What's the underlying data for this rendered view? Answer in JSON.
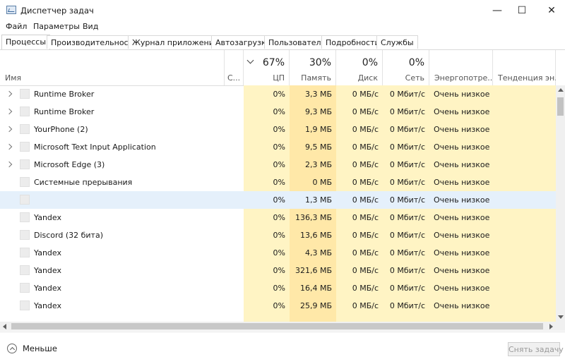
{
  "window": {
    "title": "Диспетчер задач",
    "minimize_icon": "—",
    "maximize_icon": "☐",
    "close_icon": "✕"
  },
  "menu": [
    "Файл",
    "Параметры",
    "Вид"
  ],
  "tabs": [
    "Процессы",
    "Производительность",
    "Журнал приложений",
    "Автозагрузка",
    "Пользователи",
    "Подробности",
    "Службы"
  ],
  "active_tab": "Процессы",
  "columns": {
    "name": "Имя",
    "status": "С...",
    "cpu": {
      "percent": "67%",
      "label": "ЦП"
    },
    "memory": {
      "percent": "30%",
      "label": "Память"
    },
    "disk": {
      "percent": "0%",
      "label": "Диск"
    },
    "network": {
      "percent": "0%",
      "label": "Сеть"
    },
    "power": "Энергопотре...",
    "power_trend": "Тенденция эн..."
  },
  "processes": [
    {
      "name": "Runtime Broker",
      "expandable": true,
      "cpu": "0%",
      "memory": "3,3 МБ",
      "disk": "0 МБ/с",
      "network": "0 Мбит/с",
      "power": "Очень низкое"
    },
    {
      "name": "Runtime Broker",
      "expandable": true,
      "cpu": "0%",
      "memory": "9,3 МБ",
      "disk": "0 МБ/с",
      "network": "0 Мбит/с",
      "power": "Очень низкое"
    },
    {
      "name": "YourPhone (2)",
      "expandable": true,
      "cpu": "0%",
      "memory": "1,9 МБ",
      "disk": "0 МБ/с",
      "network": "0 Мбит/с",
      "power": "Очень низкое"
    },
    {
      "name": "Microsoft Text Input Application",
      "expandable": true,
      "cpu": "0%",
      "memory": "9,5 МБ",
      "disk": "0 МБ/с",
      "network": "0 Мбит/с",
      "power": "Очень низкое"
    },
    {
      "name": "Microsoft Edge (3)",
      "expandable": true,
      "cpu": "0%",
      "memory": "2,3 МБ",
      "disk": "0 МБ/с",
      "network": "0 Мбит/с",
      "power": "Очень низкое"
    },
    {
      "name": "Системные прерывания",
      "expandable": false,
      "cpu": "0%",
      "memory": "0 МБ",
      "disk": "0 МБ/с",
      "network": "0 Мбит/с",
      "power": "Очень низкое"
    },
    {
      "name": "",
      "expandable": false,
      "selected": true,
      "cpu": "0%",
      "memory": "1,3 МБ",
      "disk": "0 МБ/с",
      "network": "0 Мбит/с",
      "power": "Очень низкое"
    },
    {
      "name": "Yandex",
      "expandable": false,
      "cpu": "0%",
      "memory": "136,3 МБ",
      "disk": "0 МБ/с",
      "network": "0 Мбит/с",
      "power": "Очень низкое"
    },
    {
      "name": "Discord (32 бита)",
      "expandable": false,
      "cpu": "0%",
      "memory": "13,6 МБ",
      "disk": "0 МБ/с",
      "network": "0 Мбит/с",
      "power": "Очень низкое"
    },
    {
      "name": "Yandex",
      "expandable": false,
      "cpu": "0%",
      "memory": "4,3 МБ",
      "disk": "0 МБ/с",
      "network": "0 Мбит/с",
      "power": "Очень низкое"
    },
    {
      "name": "Yandex",
      "expandable": false,
      "cpu": "0%",
      "memory": "321,6 МБ",
      "disk": "0 МБ/с",
      "network": "0 Мбит/с",
      "power": "Очень низкое"
    },
    {
      "name": "Yandex",
      "expandable": false,
      "cpu": "0%",
      "memory": "16,4 МБ",
      "disk": "0 МБ/с",
      "network": "0 Мбит/с",
      "power": "Очень низкое"
    },
    {
      "name": "Yandex",
      "expandable": false,
      "cpu": "0%",
      "memory": "25,9 МБ",
      "disk": "0 МБ/с",
      "network": "0 Мбит/с",
      "power": "Очень низкое"
    }
  ],
  "footer": {
    "less_label": "Меньше",
    "end_task_label": "Снять задачу"
  },
  "colors": {
    "cpu_fill": "#fff4c4",
    "memory_fill": "#ffe8a8",
    "other_fill": "#fff4c4",
    "selected_row": "#e5f0fb"
  }
}
